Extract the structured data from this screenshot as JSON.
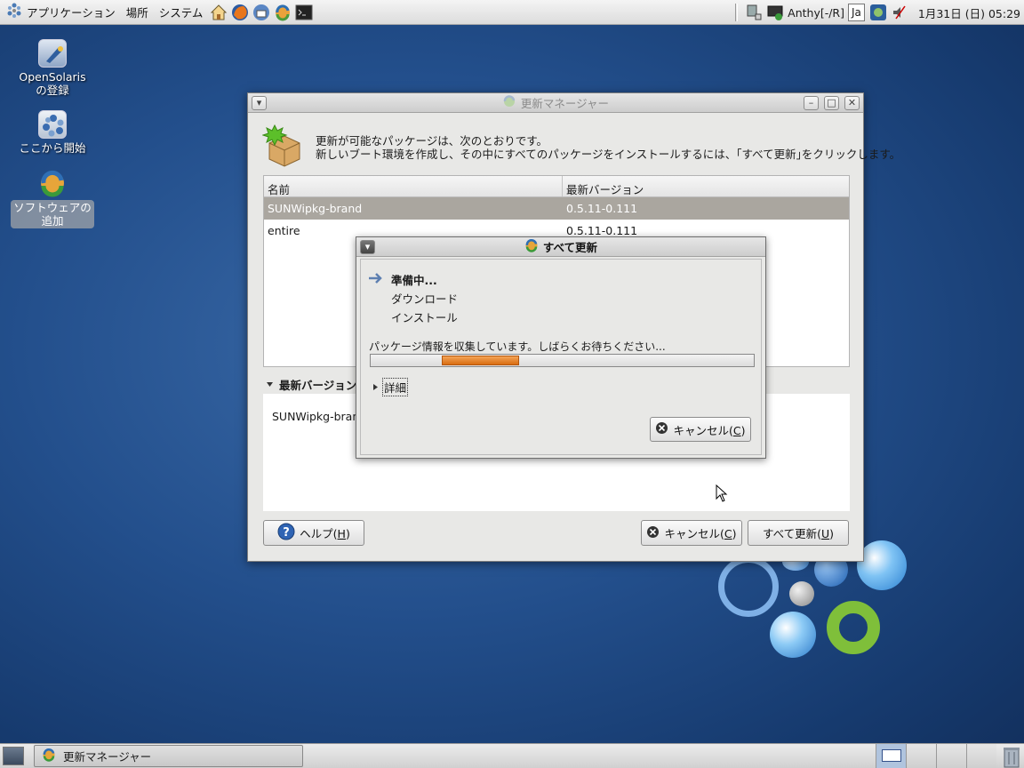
{
  "top_panel": {
    "menus": [
      "アプリケーション",
      "場所",
      "システム"
    ],
    "launchers": [
      "home-icon",
      "firefox-icon",
      "thunderbird-icon",
      "update-icon",
      "terminal-icon"
    ],
    "input_method": "Anthy[-/R]",
    "keyboard": "Ja",
    "clock": "1月31日 (日) 05:29"
  },
  "desktop": {
    "icons": [
      {
        "label": "OpenSolaris\nの登録",
        "icon": "register-icon"
      },
      {
        "label": "ここから開始",
        "icon": "start-here-icon"
      },
      {
        "label": "ソフトウェアの追加",
        "icon": "add-software-icon"
      }
    ]
  },
  "main_window": {
    "title": "更新マネージャー",
    "header_line1": "更新が可能なパッケージは、次のとおりです。",
    "header_line2": "新しいブート環境を作成し、その中にすべてのパッケージをインストールするには、｢すべて更新｣をクリックします。",
    "columns": [
      "名前",
      "最新バージョン"
    ],
    "rows": [
      {
        "name": "SUNWipkg-brand",
        "version": "0.5.11-0.111"
      },
      {
        "name": "entire",
        "version": "0.5.11-0.111"
      }
    ],
    "expander_label": "最新バージョン",
    "detail_text": "SUNWipkg-brand",
    "help_button": "ヘルプ(",
    "help_key": "H",
    "cancel_button": "キャンセル(",
    "cancel_key": "C",
    "update_all_button": "すべて更新(",
    "update_all_key": "U",
    "paren_close": ")"
  },
  "dialog": {
    "title": "すべて更新",
    "steps": [
      "準備中...",
      "ダウンロード",
      "インストール"
    ],
    "active_step": 0,
    "status": "パッケージ情報を収集しています。しばらくお待ちください...",
    "details_label": "詳細",
    "cancel_button": "キャンセル(",
    "cancel_key": "C"
  },
  "taskbar": {
    "window_item": "更新マネージャー"
  },
  "colors": {
    "progress": "#e07a1f",
    "selected_row": "#aaa69f",
    "desktop": "#234f8c"
  }
}
